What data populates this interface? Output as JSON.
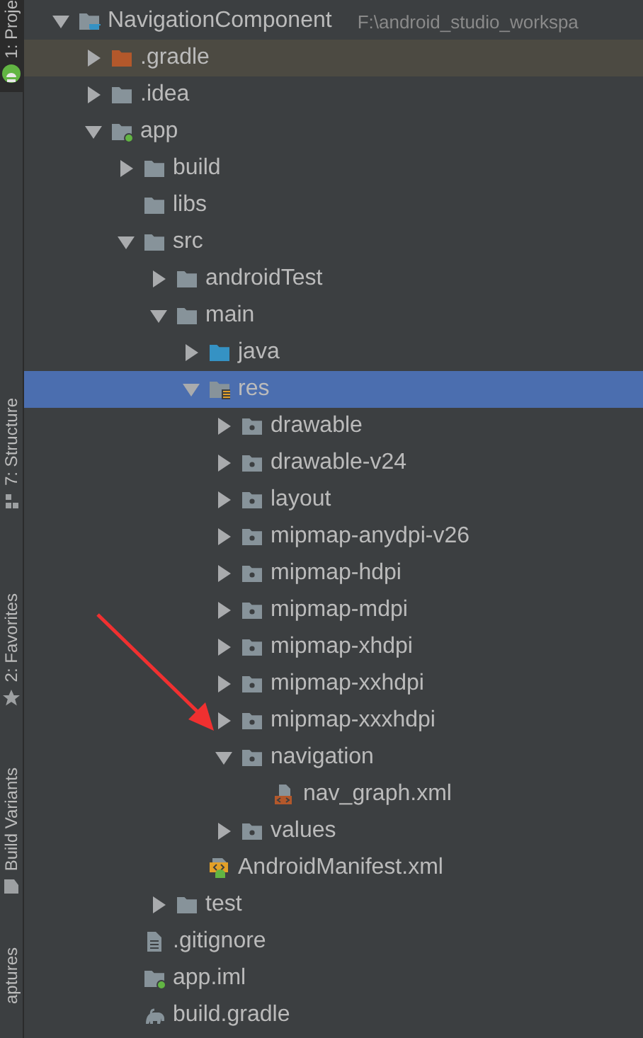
{
  "tool_window_tabs": [
    {
      "label": "1: Proje",
      "selected": true,
      "kind": "android"
    },
    {
      "label": "7: Structure",
      "selected": false,
      "kind": "structure"
    },
    {
      "label": "2: Favorites",
      "selected": false,
      "kind": "star"
    },
    {
      "label": "Build Variants",
      "selected": false,
      "kind": "variants"
    },
    {
      "label": "aptures",
      "selected": false,
      "kind": "none"
    }
  ],
  "project_tree": {
    "label": "NavigationComponent",
    "path": "F:\\android_studio_workspa",
    "kind": "project",
    "expanded": true,
    "selected": false,
    "hovered": false,
    "children": [
      {
        "label": ".gradle",
        "kind": "excluded-folder",
        "expanded": false,
        "selected": false,
        "hovered": true
      },
      {
        "label": ".idea",
        "kind": "folder",
        "expanded": false,
        "selected": false,
        "hovered": false
      },
      {
        "label": "app",
        "kind": "module-folder",
        "expanded": true,
        "selected": false,
        "hovered": false,
        "children": [
          {
            "label": "build",
            "kind": "folder",
            "expanded": false,
            "selected": false,
            "hovered": false
          },
          {
            "label": "libs",
            "kind": "folder",
            "selected": false,
            "hovered": false
          },
          {
            "label": "src",
            "kind": "folder",
            "expanded": true,
            "selected": false,
            "hovered": false,
            "children": [
              {
                "label": "androidTest",
                "kind": "folder",
                "expanded": false,
                "selected": false,
                "hovered": false
              },
              {
                "label": "main",
                "kind": "folder",
                "expanded": true,
                "selected": false,
                "hovered": false,
                "children": [
                  {
                    "label": "java",
                    "kind": "source-folder",
                    "expanded": false,
                    "selected": false,
                    "hovered": false
                  },
                  {
                    "label": "res",
                    "kind": "res-folder",
                    "expanded": true,
                    "selected": true,
                    "hovered": false,
                    "children": [
                      {
                        "label": "drawable",
                        "kind": "package-folder",
                        "expanded": false,
                        "selected": false,
                        "hovered": false
                      },
                      {
                        "label": "drawable-v24",
                        "kind": "package-folder",
                        "expanded": false,
                        "selected": false,
                        "hovered": false
                      },
                      {
                        "label": "layout",
                        "kind": "package-folder",
                        "expanded": false,
                        "selected": false,
                        "hovered": false
                      },
                      {
                        "label": "mipmap-anydpi-v26",
                        "kind": "package-folder",
                        "expanded": false,
                        "selected": false,
                        "hovered": false
                      },
                      {
                        "label": "mipmap-hdpi",
                        "kind": "package-folder",
                        "expanded": false,
                        "selected": false,
                        "hovered": false
                      },
                      {
                        "label": "mipmap-mdpi",
                        "kind": "package-folder",
                        "expanded": false,
                        "selected": false,
                        "hovered": false
                      },
                      {
                        "label": "mipmap-xhdpi",
                        "kind": "package-folder",
                        "expanded": false,
                        "selected": false,
                        "hovered": false
                      },
                      {
                        "label": "mipmap-xxhdpi",
                        "kind": "package-folder",
                        "expanded": false,
                        "selected": false,
                        "hovered": false
                      },
                      {
                        "label": "mipmap-xxxhdpi",
                        "kind": "package-folder",
                        "expanded": false,
                        "selected": false,
                        "hovered": false
                      },
                      {
                        "label": "navigation",
                        "kind": "package-folder",
                        "expanded": true,
                        "selected": false,
                        "hovered": false,
                        "children": [
                          {
                            "label": "nav_graph.xml",
                            "kind": "xml-file",
                            "selected": false,
                            "hovered": false
                          }
                        ]
                      },
                      {
                        "label": "values",
                        "kind": "package-folder",
                        "expanded": false,
                        "selected": false,
                        "hovered": false
                      }
                    ]
                  },
                  {
                    "label": "AndroidManifest.xml",
                    "kind": "manifest-file",
                    "selected": false,
                    "hovered": false
                  }
                ]
              },
              {
                "label": "test",
                "kind": "folder",
                "expanded": false,
                "selected": false,
                "hovered": false
              }
            ]
          },
          {
            "label": ".gitignore",
            "kind": "text-file",
            "selected": false,
            "hovered": false
          },
          {
            "label": "app.iml",
            "kind": "module-file",
            "selected": false,
            "hovered": false
          },
          {
            "label": "build.gradle",
            "kind": "gradle-file",
            "selected": false,
            "hovered": false
          }
        ]
      }
    ]
  }
}
